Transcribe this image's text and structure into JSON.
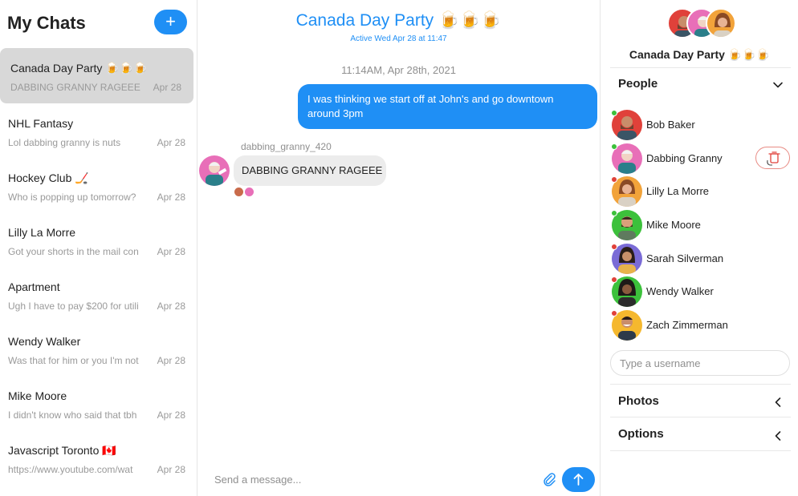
{
  "sidebar": {
    "title": "My Chats",
    "new_chat_label": "+",
    "chats": [
      {
        "name": "Canada Day Party 🍺🍺🍺",
        "preview": "DABBING GRANNY RAGEEE",
        "date": "Apr 28",
        "active": true
      },
      {
        "name": "NHL Fantasy",
        "preview": "Lol dabbing granny is nuts",
        "date": "Apr 28"
      },
      {
        "name": "Hockey Club 🏒",
        "preview": "Who is popping up tomorrow?",
        "date": "Apr 28"
      },
      {
        "name": "Lilly La Morre",
        "preview": "Got your shorts in the mail con",
        "date": "Apr 28"
      },
      {
        "name": "Apartment",
        "preview": "Ugh I have to pay $200 for utili",
        "date": "Apr 28"
      },
      {
        "name": "Wendy Walker",
        "preview": "Was that for him or you I'm not",
        "date": "Apr 28"
      },
      {
        "name": "Mike Moore",
        "preview": "I didn't know who said that tbh",
        "date": "Apr 28"
      },
      {
        "name": "Javascript Toronto 🇨🇦",
        "preview": "https://www.youtube.com/wat",
        "date": "Apr 28"
      }
    ]
  },
  "conversation": {
    "title": "Canada Day Party 🍺🍺🍺",
    "status": "Active Wed Apr 28 at 11:47",
    "date_separator": "11:14AM, Apr 28th, 2021",
    "messages": [
      {
        "direction": "out",
        "text": "I was thinking we start off at John's and go downtown around 3pm"
      },
      {
        "direction": "in",
        "sender": "dabbing_granny_420",
        "text": "DABBING GRANNY RAGEEE"
      }
    ],
    "composer_placeholder": "Send a message..."
  },
  "panel": {
    "group_name": "Canada Day Party 🍺🍺🍺",
    "people_label": "People",
    "people": [
      {
        "name": "Bob Baker",
        "online": true
      },
      {
        "name": "Dabbing Granny",
        "online": true
      },
      {
        "name": "Lilly La Morre",
        "online": false
      },
      {
        "name": "Mike Moore",
        "online": true
      },
      {
        "name": "Sarah Silverman",
        "online": false
      },
      {
        "name": "Wendy Walker",
        "online": false
      },
      {
        "name": "Zach Zimmerman",
        "online": false
      }
    ],
    "username_placeholder": "Type a username",
    "photos_label": "Photos",
    "options_label": "Options"
  },
  "colors": {
    "accent": "#1f8ff5",
    "online": "#3cc13b",
    "offline": "#e0413a",
    "remove_border": "#e88b84"
  }
}
